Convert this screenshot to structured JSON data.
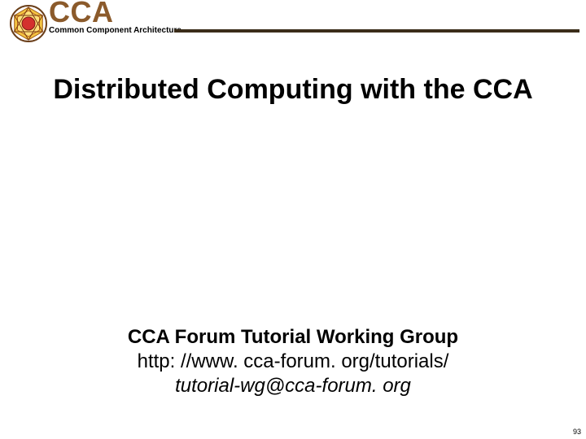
{
  "header": {
    "acronym": "CCA",
    "subtitle": "Common Component Architecture"
  },
  "title": "Distributed Computing with the CCA",
  "footer": {
    "group": "CCA Forum Tutorial Working Group",
    "url": "http: //www. cca-forum. org/tutorials/",
    "email": "tutorial-wg@cca-forum. org"
  },
  "page_number": "93",
  "colors": {
    "accent": "#8b5a2b",
    "rule": "#3b2d1a"
  }
}
